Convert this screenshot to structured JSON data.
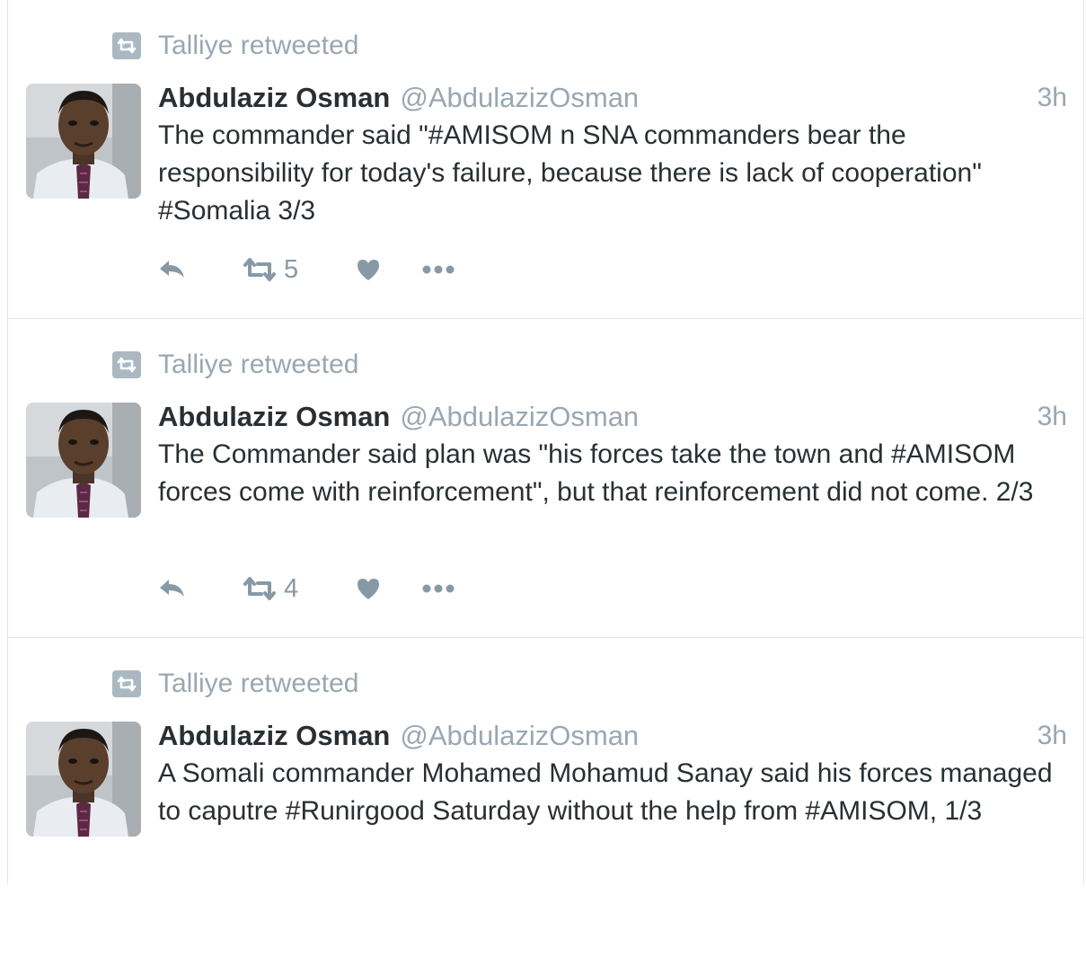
{
  "tweets": [
    {
      "context": "Talliye retweeted",
      "name": "Abdulaziz Osman",
      "handle": "@AbdulazizOsman",
      "time": "3h",
      "text": "The commander said \"#AMISOM n SNA commanders bear the responsibility for today's failure, because there is lack of cooperation\" #Somalia 3/3",
      "retweet_count": "5"
    },
    {
      "context": "Talliye retweeted",
      "name": "Abdulaziz Osman",
      "handle": "@AbdulazizOsman",
      "time": "3h",
      "text": "The Commander said plan was \"his forces take the town and #AMISOM forces come with reinforcement\", but that reinforcement did not come. 2/3",
      "retweet_count": "4"
    },
    {
      "context": "Talliye retweeted",
      "name": "Abdulaziz Osman",
      "handle": "@AbdulazizOsman",
      "time": "3h",
      "text": "A Somali commander Mohamed Mohamud Sanay said his forces managed to caputre #Runirgood Saturday without the help from #AMISOM, 1/3",
      "retweet_count": ""
    }
  ],
  "colors": {
    "text": "#292f33",
    "muted": "#9aa7b2",
    "icon": "#8899a6",
    "border": "#e1e8ed"
  },
  "icons": [
    "retweet-context-icon",
    "reply-icon",
    "retweet-icon",
    "like-icon",
    "more-icon"
  ]
}
